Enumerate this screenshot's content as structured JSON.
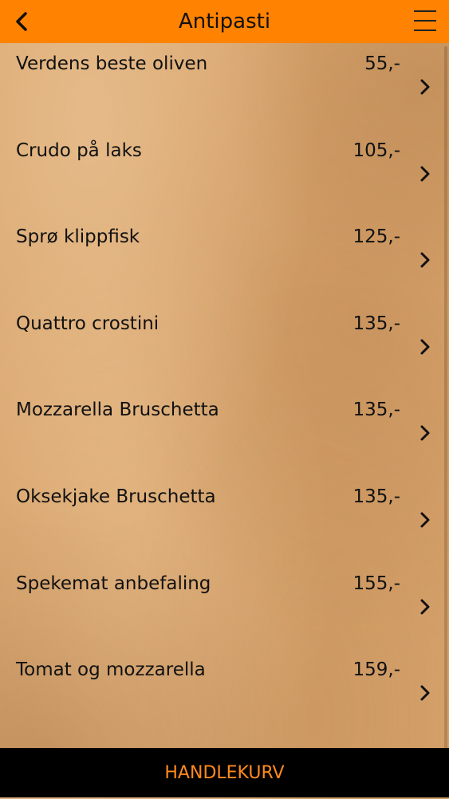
{
  "header": {
    "title": "Antipasti",
    "back_icon": "chevron-left-icon",
    "menu_icon": "hamburger-menu-icon",
    "background_color": "#ff8200"
  },
  "menu_items": [
    {
      "name": "Verdens beste oliven",
      "price": "55,-"
    },
    {
      "name": "Crudo på laks",
      "price": "105,-"
    },
    {
      "name": "Sprø klippfisk",
      "price": "125,-"
    },
    {
      "name": "Quattro crostini",
      "price": "135,-"
    },
    {
      "name": "Mozzarella Bruschetta",
      "price": "135,-"
    },
    {
      "name": "Oksekjake Bruschetta",
      "price": "135,-"
    },
    {
      "name": "Spekemat anbefaling",
      "price": "155,-"
    },
    {
      "name": "Tomat og mozzarella",
      "price": "159,-"
    }
  ],
  "item_icon": "chevron-right-icon",
  "footer": {
    "label": "HANDLEKURV",
    "background_color": "#000000",
    "text_color": "#ff8a1c"
  }
}
